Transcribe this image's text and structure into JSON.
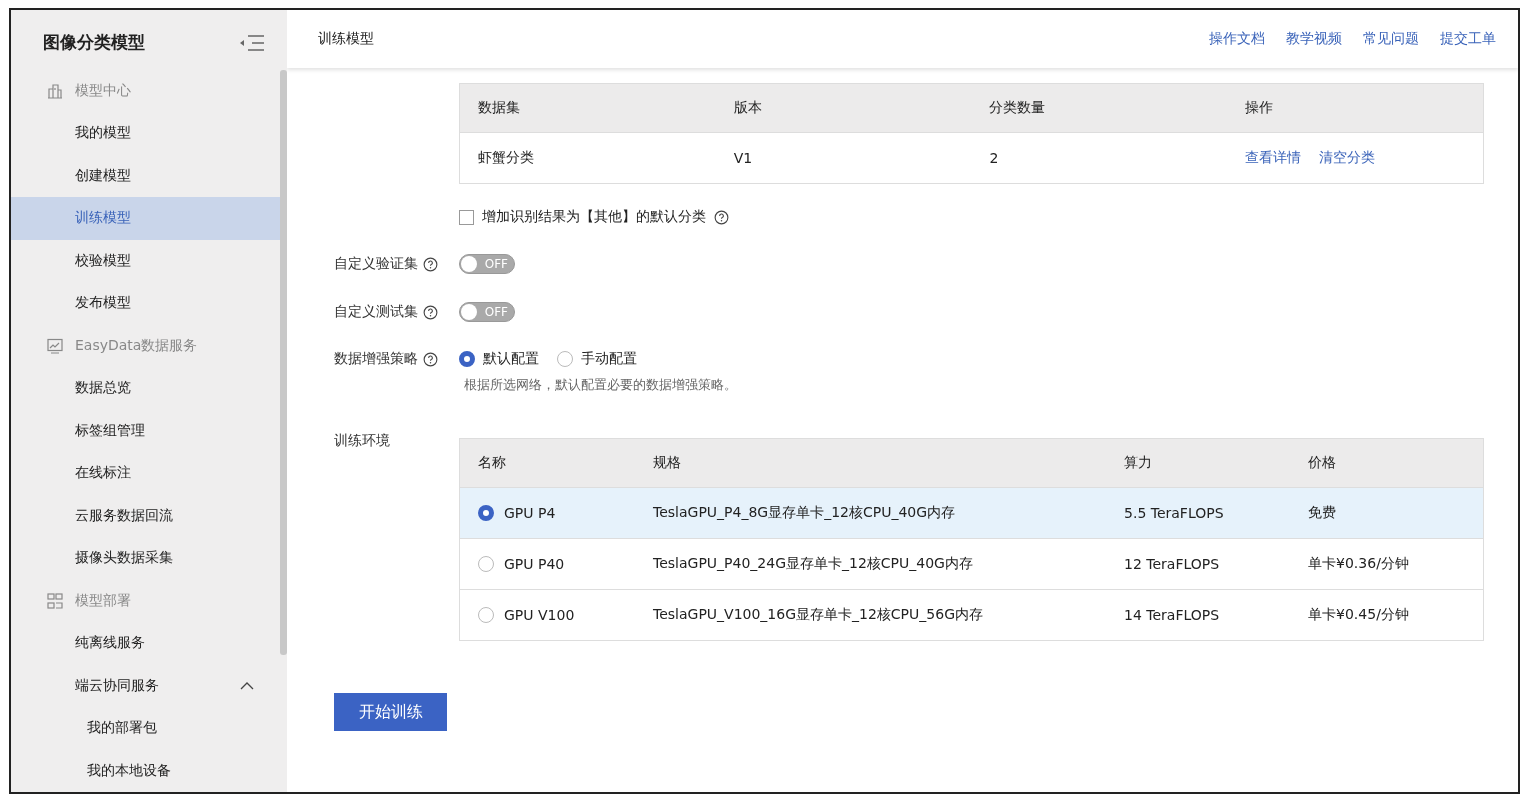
{
  "sidebar": {
    "title": "图像分类模型",
    "groups": [
      {
        "label": "模型中心",
        "kind": "center",
        "children": [
          {
            "label": "我的模型",
            "selected": false
          },
          {
            "label": "创建模型",
            "selected": false
          },
          {
            "label": "训练模型",
            "selected": true
          },
          {
            "label": "校验模型",
            "selected": false
          },
          {
            "label": "发布模型",
            "selected": false
          }
        ]
      },
      {
        "label": "EasyData数据服务",
        "kind": "data",
        "children": [
          {
            "label": "数据总览",
            "selected": false
          },
          {
            "label": "标签组管理",
            "selected": false
          },
          {
            "label": "在线标注",
            "selected": false
          },
          {
            "label": "云服务数据回流",
            "selected": false
          },
          {
            "label": "摄像头数据采集",
            "selected": false
          }
        ]
      },
      {
        "label": "模型部署",
        "kind": "deploy",
        "children": [
          {
            "label": "纯离线服务",
            "selected": false
          },
          {
            "label": "端云协同服务",
            "selected": false,
            "expanded": true,
            "children": [
              {
                "label": "我的部署包",
                "selected": false
              },
              {
                "label": "我的本地设备",
                "selected": false
              }
            ]
          }
        ]
      }
    ]
  },
  "header": {
    "title": "训练模型",
    "links": [
      "操作文档",
      "教学视频",
      "常见问题",
      "提交工单"
    ]
  },
  "dataset_table": {
    "columns": [
      "数据集",
      "版本",
      "分类数量",
      "操作"
    ],
    "rows": [
      {
        "cells": [
          "虾蟹分类",
          "V1",
          "2"
        ],
        "actions": [
          "查看详情",
          "清空分类"
        ]
      }
    ]
  },
  "other_class_checkbox": {
    "label": "增加识别结果为【其他】的默认分类",
    "checked": false
  },
  "toggles": [
    {
      "label": "自定义验证集",
      "on": false,
      "text": "OFF"
    },
    {
      "label": "自定义测试集",
      "on": false,
      "text": "OFF"
    }
  ],
  "augmentation": {
    "label": "数据增强策略",
    "options": [
      {
        "label": "默认配置",
        "selected": true
      },
      {
        "label": "手动配置",
        "selected": false
      }
    ],
    "hint": "根据所选网络，默认配置必要的数据增强策略。"
  },
  "environment": {
    "label": "训练环境",
    "columns": [
      "名称",
      "规格",
      "算力",
      "价格"
    ],
    "rows": [
      {
        "name": "GPU P4",
        "spec": "TeslaGPU_P4_8G显存单卡_12核CPU_40G内存",
        "compute": "5.5 TeraFLOPS",
        "price": "免费",
        "selected": true
      },
      {
        "name": "GPU P40",
        "spec": "TeslaGPU_P40_24G显存单卡_12核CPU_40G内存",
        "compute": "12 TeraFLOPS",
        "price": "单卡¥0.36/分钟",
        "selected": false
      },
      {
        "name": "GPU V100",
        "spec": "TeslaGPU_V100_16G显存单卡_12核CPU_56G内存",
        "compute": "14 TeraFLOPS",
        "price": "单卡¥0.45/分钟",
        "selected": false
      }
    ]
  },
  "start_button": "开始训练"
}
